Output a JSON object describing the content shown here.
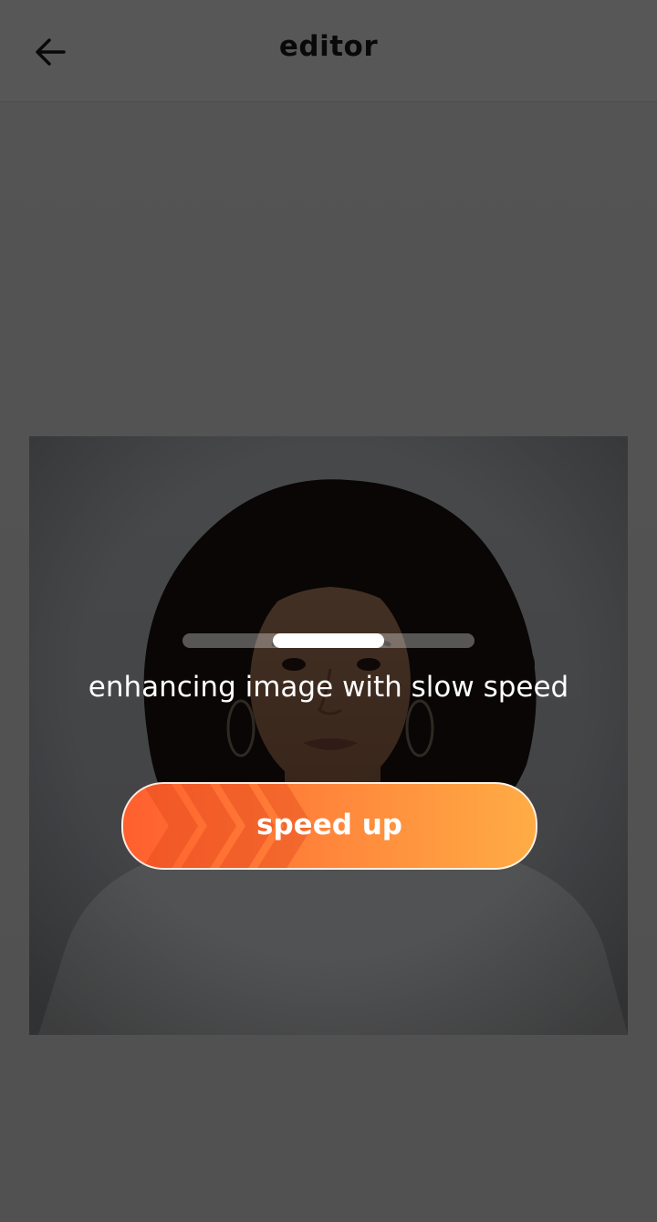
{
  "header": {
    "title": "editor",
    "back_icon": "arrow-left-icon"
  },
  "photo": {
    "subject": "portrait-photo",
    "background_color": "#c9ccd2",
    "shirt_color": "#f2f3f5"
  },
  "overlay": {
    "status_text": "enhancing image with slow speed",
    "progress_fraction": 0.38,
    "speed_button_label": "speed up",
    "speed_button_icon": "fast-forward-chevrons-icon"
  },
  "colors": {
    "app_bar": "#ffffff",
    "title_text": "#1d1d1f",
    "button_gradient_start": "#ff5f2e",
    "button_gradient_end": "#ffac45",
    "scrim": "rgba(0,0,0,0.66)"
  }
}
